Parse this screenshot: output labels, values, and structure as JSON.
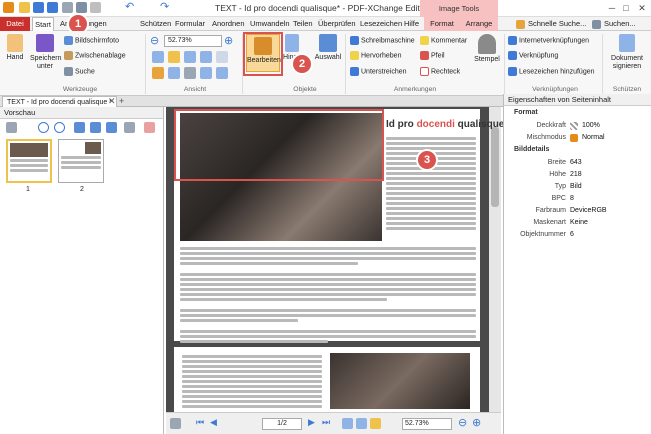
{
  "window": {
    "title": "TEXT - Id pro docendi qualisque* - PDF-XChange Editor",
    "context_tab_group": "Image Tools",
    "min_glyph": "─",
    "max_glyph": "□",
    "close_glyph": "✕"
  },
  "menu": {
    "tabs": [
      "Datei",
      "Start",
      "Anmerkungen",
      "Schützen",
      "Formular",
      "Anordnen",
      "Umwandeln",
      "Teilen",
      "Überprüfen",
      "Lesezeichen",
      "Hilfe",
      "Format",
      "Arrange"
    ],
    "quick_search": "Schnelle Suche...",
    "search": "Suchen..."
  },
  "ribbon": {
    "werkzeuge": {
      "hand": "Hand",
      "save": "Speichern unter",
      "snapshot": "Bildschirmfoto",
      "clipboard": "Zwischenablage",
      "search": "Suche",
      "group": "Werkzeuge"
    },
    "ansicht": {
      "zoom": "52.73%",
      "group": "Ansicht"
    },
    "objekte": {
      "edit": "Bearbeiten",
      "hinzu": "Hinzu",
      "select": "Auswahl",
      "group": "Objekte"
    },
    "anmerkungen": {
      "typewriter": "Schreibmaschine",
      "comment": "Kommentar",
      "highlight": "Hervorheben",
      "arrow": "Pfeil",
      "underline": "Unterstreichen",
      "rectangle": "Rechteck",
      "group": "Anmerkungen"
    },
    "stempel": {
      "label": "Stempel"
    },
    "verknuepfungen": {
      "internet": "Internetverknüpfungen",
      "link": "Verknüpfung",
      "bookmark": "Lesezeichen hinzufügen",
      "group": "Verknüpfungen"
    },
    "schuetzen": {
      "sign": "Dokument signieren",
      "group": "Schützen"
    }
  },
  "doc_tab": {
    "label": "TEXT - Id pro docendi qualisque *"
  },
  "left_panel": {
    "title": "Vorschau",
    "pages": [
      "1",
      "2"
    ]
  },
  "document": {
    "heading_prefix": "Id pro ",
    "heading_red": "docendi",
    "heading_suffix": " qualisque"
  },
  "callouts": [
    "1",
    "2",
    "3"
  ],
  "status": {
    "page": "1/2",
    "zoom": "52.73%"
  },
  "right_panel": {
    "title": "Eigenschaften von Seiteninhalt",
    "format_section": "Format",
    "opacity_label": "Deckkraft",
    "opacity_value": "100%",
    "blend_label": "Mischmodus",
    "blend_value": "Normal",
    "image_section": "Bilddetails",
    "rows": [
      {
        "k": "Breite",
        "v": "643"
      },
      {
        "k": "Höhe",
        "v": "218"
      },
      {
        "k": "Typ",
        "v": "Bild"
      },
      {
        "k": "BPC",
        "v": "8"
      },
      {
        "k": "Farbraum",
        "v": "DeviceRGB"
      },
      {
        "k": "Maskenart",
        "v": "Keine"
      },
      {
        "k": "Objektnummer",
        "v": "6"
      }
    ]
  },
  "colors": {
    "accent_red": "#d9534f",
    "datei_tab": "#c9302c",
    "ribbon_bg": "#f7f7f7",
    "workspace": "#4a4a4a"
  }
}
